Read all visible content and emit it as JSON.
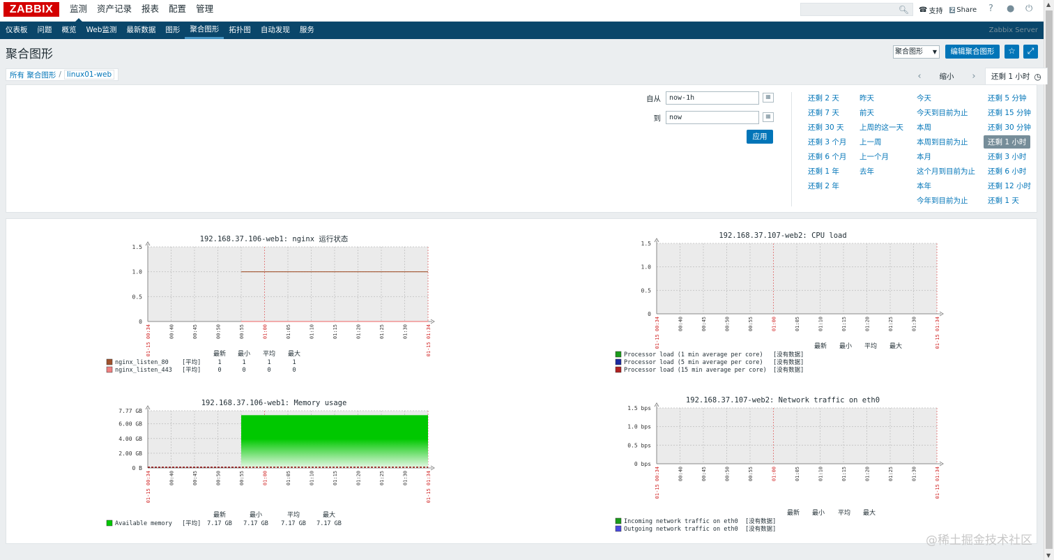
{
  "app": {
    "logo": "ZABBIX",
    "server_name": "Zabbix Server"
  },
  "top_menu": [
    {
      "label": "监测",
      "selected": true
    },
    {
      "label": "资产记录",
      "selected": false
    },
    {
      "label": "报表",
      "selected": false
    },
    {
      "label": "配置",
      "selected": false
    },
    {
      "label": "管理",
      "selected": false
    }
  ],
  "header": {
    "search_placeholder": "",
    "support_label": "支持",
    "share_label": "Share",
    "help_icon": "help-icon",
    "user_icon": "user-icon",
    "logout_icon": "power-icon"
  },
  "sub_menu": [
    {
      "label": "仪表板",
      "selected": false
    },
    {
      "label": "问题",
      "selected": false
    },
    {
      "label": "概览",
      "selected": false
    },
    {
      "label": "Web监测",
      "selected": false
    },
    {
      "label": "最新数据",
      "selected": false
    },
    {
      "label": "图形",
      "selected": false
    },
    {
      "label": "聚合图形",
      "selected": true
    },
    {
      "label": "拓扑图",
      "selected": false
    },
    {
      "label": "自动发现",
      "selected": false
    },
    {
      "label": "服务",
      "selected": false
    }
  ],
  "page": {
    "title": "聚合图形",
    "select_value": "聚合图形",
    "edit_button": "编辑聚合图形",
    "favorite_icon": "star-icon",
    "fullscreen_icon": "fullscreen-icon"
  },
  "breadcrumb": {
    "root": "所有 聚合图形",
    "separator": "/",
    "current": "linux01-web"
  },
  "time_nav": {
    "zoom_out": "缩小",
    "active_tab": "还剩 1 小时"
  },
  "filter": {
    "from_label": "自从",
    "from_value": "now-1h",
    "to_label": "到",
    "to_value": "now",
    "apply_button": "应用",
    "quick_ranges": [
      [
        "还剩 2 天",
        "还剩 7 天",
        "还剩 30 天",
        "还剩 3 个月",
        "还剩 6 个月",
        "还剩 1 年",
        "还剩 2 年"
      ],
      [
        "昨天",
        "前天",
        "上周的这一天",
        "上一周",
        "上一个月",
        "去年"
      ],
      [
        "今天",
        "今天到目前为止",
        "本周",
        "本周到目前为止",
        "本月",
        "这个月到目前为止",
        "本年",
        "今年到目前为止"
      ],
      [
        "还剩 5 分钟",
        "还剩 15 分钟",
        "还剩 30 分钟",
        "还剩 1 小时",
        "还剩 3 小时",
        "还剩 6 小时",
        "还剩 12 小时",
        "还剩 1 天"
      ]
    ],
    "selected_range": "还剩 1 小时"
  },
  "x_ticks": [
    "01-15 00:34",
    "00:40",
    "00:45",
    "00:50",
    "00:55",
    "01:00",
    "01:05",
    "01:10",
    "01:15",
    "01:20",
    "01:25",
    "01:30",
    "01-15 01:34"
  ],
  "legend_headers": {
    "last": "最新",
    "min": "最小",
    "avg": "平均",
    "max": "最大"
  },
  "chart_data": [
    {
      "type": "line",
      "title": "192.168.37.106-web1: nginx 运行状态",
      "ylim": [
        0,
        1.5
      ],
      "y_ticks": [
        "1.5",
        "1.0",
        "0.5",
        "0"
      ],
      "data_start": "00:55",
      "series": [
        {
          "name": "nginx_listen_80",
          "color": "#a0522d",
          "func": "[平均]",
          "value": 1,
          "last": "1",
          "min": "1",
          "avg": "1",
          "max": "1"
        },
        {
          "name": "nginx_listen_443",
          "color": "#f08080",
          "func": "[平均]",
          "value": 0,
          "last": "0",
          "min": "0",
          "avg": "0",
          "max": "0"
        }
      ]
    },
    {
      "type": "line",
      "title": "192.168.37.107-web2: CPU load",
      "ylim": [
        0,
        1.5
      ],
      "y_ticks": [
        "1.5",
        "1.0",
        "0.5",
        "0"
      ],
      "series": [
        {
          "name": "Processor load (1 min average per core)",
          "color": "#1a9b1a",
          "nodata": "[没有数据]"
        },
        {
          "name": "Processor load (5 min average per core)",
          "color": "#1a2aa0",
          "nodata": "[没有数据]"
        },
        {
          "name": "Processor load (15 min average per core)",
          "color": "#b02020",
          "nodata": "[没有数据]"
        }
      ]
    },
    {
      "type": "area",
      "title": "192.168.37.106-web1: Memory usage",
      "ylim": [
        0,
        7.77
      ],
      "y_ticks": [
        "7.77 GB",
        "6.00 GB",
        "4.00 GB",
        "2.00 GB",
        "0 B"
      ],
      "data_start": "00:55",
      "series": [
        {
          "name": "Available memory",
          "color": "#00c800",
          "func": "[平均]",
          "value": 7.17,
          "last": "7.17 GB",
          "min": "7.17 GB",
          "avg": "7.17 GB",
          "max": "7.17 GB"
        }
      ]
    },
    {
      "type": "line",
      "title": "192.168.37.107-web2: Network traffic on eth0",
      "ylim": [
        0,
        1.5
      ],
      "y_ticks": [
        "1.5 bps",
        "1.0 bps",
        "0.5 bps",
        "0 bps"
      ],
      "series": [
        {
          "name": "Incoming network traffic on eth0",
          "color": "#1a9b1a",
          "nodata": "[没有数据]"
        },
        {
          "name": "Outgoing network traffic on eth0",
          "color": "#4a4ae0",
          "nodata": "[没有数据]"
        }
      ]
    }
  ],
  "watermark": "@稀土掘金技术社区"
}
